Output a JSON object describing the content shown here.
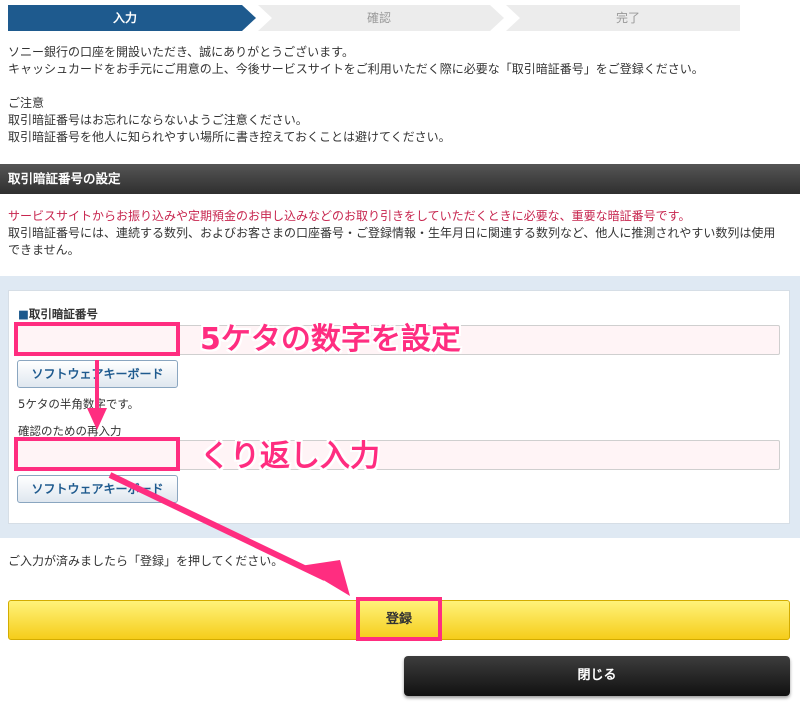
{
  "steps": [
    {
      "label": "入力",
      "active": true
    },
    {
      "label": "確認",
      "active": false
    },
    {
      "label": "完了",
      "active": false
    }
  ],
  "intro": {
    "line1": "ソニー銀行の口座を開設いただき、誠にありがとうございます。",
    "line2": "キャッシュカードをお手元にご用意の上、今後サービスサイトをご利用いただく際に必要な「取引暗証番号」をご登録ください。",
    "notice_title": "ご注意",
    "notice1": "取引暗証番号はお忘れにならないようご注意ください。",
    "notice2": "取引暗証番号を他人に知られやすい場所に書き控えておくことは避けてください。"
  },
  "section": {
    "title": "取引暗証番号の設定",
    "red_text": "サービスサイトからお振り込みや定期預金のお申し込みなどのお取り引きをしていただくときに必要な、重要な暗証番号です。",
    "desc1": "取引暗証番号には、連続する数列、およびお客さまの口座番号・ご登録情報・生年月日に関連する数列など、他人に推測されやすい数列は使用",
    "desc2": "できません。"
  },
  "form": {
    "pin_label": "取引暗証番号",
    "pin_value": "",
    "keyboard_label": "ソフトウェアキーボード",
    "pin_hint": "5ケタの半角数字です。",
    "confirm_label": "確認のための再入力",
    "confirm_value": ""
  },
  "annotations": {
    "anno1": "5ケタの数字を設定",
    "anno2": "くり返し入力"
  },
  "footer": {
    "instruction": "ご入力が済みましたら「登録」を押してください。",
    "register_label": "登録",
    "close_label": "閉じる"
  },
  "colors": {
    "active_step": "#1e5a8e",
    "inactive_step": "#ececec",
    "highlight": "#ff2d80",
    "register_button": "#f7d62c",
    "close_button": "#222222"
  }
}
